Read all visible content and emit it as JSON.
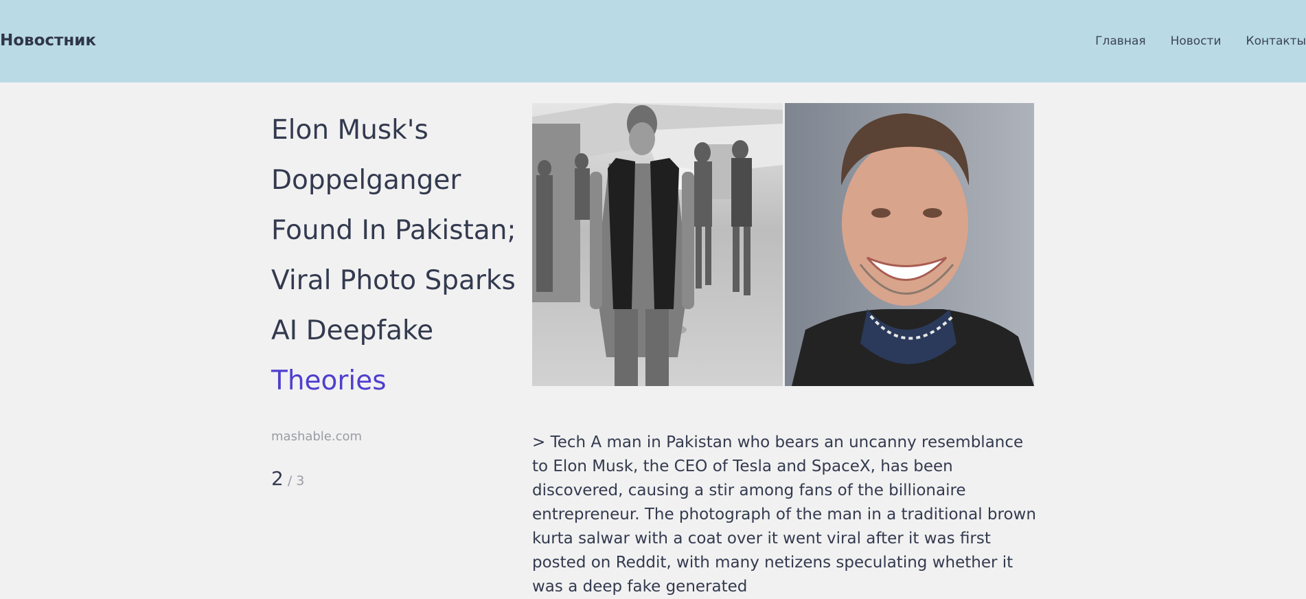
{
  "header": {
    "brand": "Новостник",
    "nav": [
      "Главная",
      "Новости",
      "Контакты"
    ]
  },
  "article": {
    "title_main": "Elon Musk's Doppelganger Found In Pakistan; Viral Photo Sparks AI Deepfake ",
    "title_highlight": "Theories",
    "source": "mashable.com",
    "page_current": "2",
    "page_sep": " / 3",
    "body": "> Tech A man in Pakistan who bears an uncanny resemblance to Elon Musk, the CEO of Tesla and SpaceX, has been discovered, causing a stir among fans of the billionaire entrepreneur. The photograph of the man in a traditional brown kurta salwar with a coat over it went viral after it was first posted on Reddit, with many netizens speculating whether it was a deep fake generated"
  },
  "colors": {
    "header_bg": "#badbe5",
    "page_bg": "#f1f1f1",
    "accent": "#4e3fcf",
    "text": "#333a4f",
    "muted": "#9a9ca4"
  }
}
